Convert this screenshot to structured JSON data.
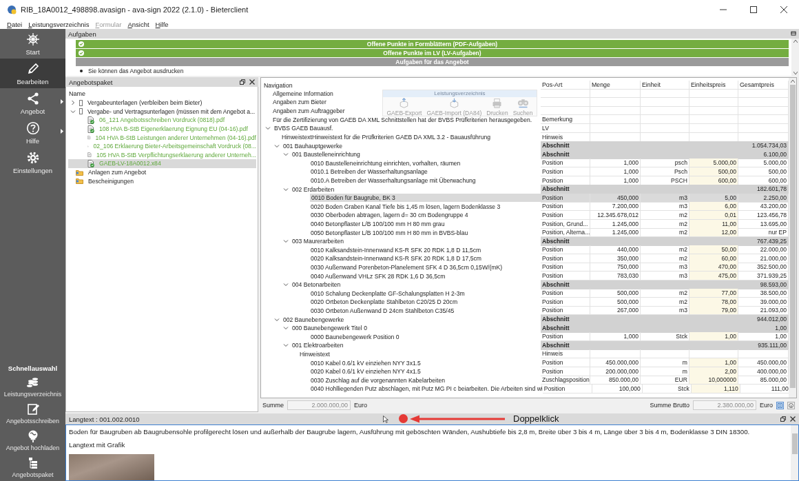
{
  "window": {
    "title": "RIB_18A0012_498898.avasign - ava-sign 2022 (2.1.0) - Bieterclient"
  },
  "menu": [
    {
      "label": "Datei",
      "disabled": false
    },
    {
      "label": "Leistungsverzeichnis",
      "disabled": false
    },
    {
      "label": "Formular",
      "disabled": true
    },
    {
      "label": "Ansicht",
      "disabled": false
    },
    {
      "label": "Hilfe",
      "disabled": false
    }
  ],
  "sidebar": {
    "items": [
      {
        "label": "Start",
        "kind": "start",
        "selected": false,
        "has_submenu": false
      },
      {
        "label": "Bearbeiten",
        "kind": "edit",
        "selected": true,
        "has_submenu": false
      },
      {
        "label": "Angebot",
        "kind": "share",
        "selected": false,
        "has_submenu": true
      },
      {
        "label": "Hilfe",
        "kind": "help",
        "selected": false,
        "has_submenu": true
      },
      {
        "label": "Einstellungen",
        "kind": "settings",
        "selected": false,
        "has_submenu": false
      }
    ],
    "quick_title": "Schnellauswahl",
    "quick_items": [
      {
        "label": "Leistungsverzeichnis",
        "kind": "coins"
      },
      {
        "label": "Angebotsschreiben",
        "kind": "letter"
      },
      {
        "label": "Angebot hochladen",
        "kind": "upload"
      },
      {
        "label": "Angebotspaket",
        "kind": "package"
      }
    ]
  },
  "tasks": {
    "title": "Aufgaben",
    "items": [
      {
        "kind": "done",
        "label": "Offene Punkte in Formblättern (PDF-Aufgaben)"
      },
      {
        "kind": "done",
        "label": "Offene Punkte im LV (LV-Aufgaben)"
      },
      {
        "kind": "heading",
        "label": "Aufgaben für das Angebot"
      },
      {
        "kind": "bullet",
        "label": "Sie können das Angebot ausdrucken"
      }
    ]
  },
  "package": {
    "title": "Angebotspaket",
    "column": "Name",
    "items": [
      {
        "label": "Vergabeunterlagen (verbleiben beim Bieter)",
        "kind": "group",
        "expanded": false,
        "selected": false
      },
      {
        "label": "Vergabe- und Vertragsunterlagen (müssen mit dem Angebot a...",
        "kind": "group",
        "expanded": true,
        "selected": false,
        "children": [
          {
            "label": "06_121 Angebotsschreiben Vordruck (0818).pdf",
            "kind": "file",
            "signed": true,
            "selected": false
          },
          {
            "label": "108 HVA B-StB Eigenerklaerung Eignung EU (04-16).pdf",
            "kind": "file",
            "signed": true,
            "selected": false
          },
          {
            "label": "104 HVA B-StB Leistungen anderer Unternehmen (04-16).pdf",
            "kind": "file",
            "signed": false,
            "selected": false
          },
          {
            "label": "02_106 Erklaerung Bieter-Arbeitsgemeinschaft Vordruck (08...",
            "kind": "file",
            "signed": false,
            "selected": false
          },
          {
            "label": "105 HVA B-StB Verpflichtungserklaerung anderer Unterneh...",
            "kind": "file",
            "signed": false,
            "selected": false
          },
          {
            "label": "GAEB-LV-18A0012.x84",
            "kind": "file",
            "signed": true,
            "selected": true
          }
        ]
      },
      {
        "label": "Anlagen zum Angebot",
        "kind": "folder",
        "selected": false
      },
      {
        "label": "Bescheinigungen",
        "kind": "folder",
        "selected": false
      }
    ]
  },
  "lv": {
    "columns": [
      "Navigation",
      "Pos-Art",
      "Menge",
      "Einheit",
      "Einheitspreis",
      "Gesamtpreis"
    ],
    "toolbar": {
      "title": "Leistungsverzeichnis",
      "buttons": [
        {
          "label": "GAEB-Export",
          "kind": "export"
        },
        {
          "label": "GAEB-Import (DA84)",
          "kind": "import"
        },
        {
          "label": "Drucken",
          "kind": "print"
        },
        {
          "label": "Suchen",
          "kind": "search"
        }
      ]
    },
    "rows": [
      {
        "label": "Allgemeine Information",
        "kind": "text",
        "selected": false
      },
      {
        "label": "Angaben zum Bieter",
        "kind": "text",
        "selected": false
      },
      {
        "label": "Angaben zum Auftraggeber",
        "kind": "text",
        "selected": false
      },
      {
        "label": "Für die Zertifizierung von GAEB DA XML Schnittstellen hat der BVBS Prüfkriterien herausgegeben.",
        "kind": "text",
        "selected": false,
        "pos_art": "Bemerkung"
      },
      {
        "label": "BVBS GAEB Bauausf.",
        "kind": "text",
        "selected": false,
        "pos_art": "LV",
        "expanded": true,
        "children": [
          {
            "label": "HinweistextHinweistext für die Prüfkriterien GAEB DA XML 3.2 - Bauausführung",
            "kind": "text",
            "selected": false,
            "pos_art": "Hinweis"
          },
          {
            "label": "001 Bauhauptgewerke",
            "kind": "section",
            "selected": false,
            "pos_art": "Abschnitt",
            "gp": "1.054.734,03",
            "expanded": true,
            "children": [
              {
                "label": "001 Baustelleneinrichtung",
                "kind": "section",
                "selected": false,
                "pos_art": "Abschnitt",
                "gp": "6.100,00",
                "expanded": true,
                "children": [
                  {
                    "label": "0010 Baustelleneinrichtung einrichten, vorhalten, räumen",
                    "kind": "position",
                    "selected": false,
                    "pos_art": "Position",
                    "menge": "1,000",
                    "einheit": "psch",
                    "ep": "5.000,00",
                    "gp": "5.000,00"
                  },
                  {
                    "label": "0010.1 Betreiben der Wasserhaltungsanlage",
                    "kind": "position",
                    "selected": false,
                    "pos_art": "Position",
                    "menge": "1,000",
                    "einheit": "Psch",
                    "ep": "500,00",
                    "gp": "500,00"
                  },
                  {
                    "label": "0010.A Betreiben der Wasserhaltungsanlage mit Überwachung",
                    "kind": "position",
                    "selected": false,
                    "pos_art": "Position",
                    "menge": "1,000",
                    "einheit": "PSCH",
                    "ep": "600,00",
                    "gp": "600,00"
                  }
                ]
              },
              {
                "label": "002 Erdarbeiten",
                "kind": "section",
                "selected": false,
                "pos_art": "Abschnitt",
                "gp": "182.601,78",
                "expanded": true,
                "children": [
                  {
                    "label": "0010 Boden für Baugrube, BK 3",
                    "kind": "position",
                    "selected": true,
                    "pos_art": "Position",
                    "menge": "450,000",
                    "einheit": "m3",
                    "ep": "5,00",
                    "gp": "2.250,00"
                  },
                  {
                    "label": "0020 Boden Graben Kanal Tiefe bis 1,45 m lösen, lagern Bodenklasse 3",
                    "kind": "position",
                    "selected": false,
                    "pos_art": "Position",
                    "menge": "7.200,000",
                    "einheit": "m3",
                    "ep": "6,00",
                    "gp": "43.200,00"
                  },
                  {
                    "label": "0030 Oberboden abtragen, lagern d= 30 cm Bodengruppe 4",
                    "kind": "position",
                    "selected": false,
                    "pos_art": "Position",
                    "menge": "12.345.678,012",
                    "einheit": "m2",
                    "ep": "0,01",
                    "gp": "123.456,78"
                  },
                  {
                    "label": "0040 Betonpflaster L/B 100/100 mm H 80 mm grau",
                    "kind": "position",
                    "selected": false,
                    "pos_art": "Position, Grund...",
                    "menge": "1.245,000",
                    "einheit": "m2",
                    "ep": "11,00",
                    "gp": "13.695,00"
                  },
                  {
                    "label": "0050 Betonpflaster L/B 100/100 mm H 80 mm in BVBS-blau",
                    "kind": "position",
                    "selected": false,
                    "pos_art": "Position, Alterna...",
                    "menge": "1.245,000",
                    "einheit": "m2",
                    "ep": "12,00",
                    "gp": "nur EP"
                  }
                ]
              },
              {
                "label": "003 Maurerarbeiten",
                "kind": "section",
                "selected": false,
                "pos_art": "Abschnitt",
                "gp": "767.439,25",
                "expanded": true,
                "children": [
                  {
                    "label": "0010 Kalksandstein-Innenwand KS-R SFK 20 RDK 1,8 D 11,5cm",
                    "kind": "position",
                    "selected": false,
                    "pos_art": "Position",
                    "menge": "440,000",
                    "einheit": "m2",
                    "ep": "50,00",
                    "gp": "22.000,00"
                  },
                  {
                    "label": "0020 Kalksandstein-Innenwand KS-R SFK 20 RDK 1,8 D 17,5cm",
                    "kind": "position",
                    "selected": false,
                    "pos_art": "Position",
                    "menge": "350,000",
                    "einheit": "m2",
                    "ep": "60,00",
                    "gp": "21.000,00"
                  },
                  {
                    "label": "0030 Außenwand Porenbeton-Planelement SFK 4 D 36,5cm 0,15W/(mK)",
                    "kind": "position",
                    "selected": false,
                    "pos_art": "Position",
                    "menge": "750,000",
                    "einheit": "m3",
                    "ep": "470,00",
                    "gp": "352.500,00"
                  },
                  {
                    "label": "0040 Außenwand VHLz SFK 28 RDK 1,6 D 36,5cm",
                    "kind": "position",
                    "selected": false,
                    "pos_art": "Position",
                    "menge": "783,030",
                    "einheit": "m3",
                    "ep": "475,00",
                    "gp": "371.939,25"
                  }
                ]
              },
              {
                "label": "004 Betonarbeiten",
                "kind": "section",
                "selected": false,
                "pos_art": "Abschnitt",
                "gp": "98.593,00",
                "expanded": true,
                "children": [
                  {
                    "label": "0010 Schalung Deckenplatte GF-Schalungsplatten H 2-3m",
                    "kind": "position",
                    "selected": false,
                    "pos_art": "Position",
                    "menge": "500,000",
                    "einheit": "m2",
                    "ep": "77,00",
                    "gp": "38.500,00"
                  },
                  {
                    "label": "0020 Ortbeton Deckenplatte Stahlbeton C20/25 D 20cm",
                    "kind": "position",
                    "selected": false,
                    "pos_art": "Position",
                    "menge": "500,000",
                    "einheit": "m2",
                    "ep": "78,00",
                    "gp": "39.000,00"
                  },
                  {
                    "label": "0030 Ortbeton Außenwand D 24cm Stahlbeton C35/45",
                    "kind": "position",
                    "selected": false,
                    "pos_art": "Position",
                    "menge": "267,000",
                    "einheit": "m3",
                    "ep": "79,00",
                    "gp": "21.093,00"
                  }
                ]
              }
            ]
          },
          {
            "label": "002 Baunebengewerke",
            "kind": "section",
            "selected": false,
            "pos_art": "Abschnitt",
            "gp": "944.012,00",
            "expanded": true,
            "children": [
              {
                "label": "000 Baunebengewerk Titel 0",
                "kind": "section",
                "selected": false,
                "pos_art": "Abschnitt",
                "gp": "1,00",
                "expanded": true,
                "children": [
                  {
                    "label": "0000 Baunebengewerk Position 0",
                    "kind": "position",
                    "selected": false,
                    "pos_art": "Position",
                    "menge": "1,000",
                    "einheit": "Stck",
                    "ep": "1,00",
                    "gp": "1,00"
                  }
                ]
              },
              {
                "label": "001 Elektroarbeiten",
                "kind": "section",
                "selected": false,
                "pos_art": "Abschnitt",
                "gp": "935.111,00",
                "expanded": true,
                "children": [
                  {
                    "label": "Hinweistext",
                    "kind": "text",
                    "selected": false,
                    "pos_art": "Hinweis"
                  },
                  {
                    "label": "0010 Kabel 0.6/1 kV einziehen NYY 3x1.5",
                    "kind": "position",
                    "selected": false,
                    "pos_art": "Position",
                    "menge": "450.000,000",
                    "einheit": "m",
                    "ep": "1,00",
                    "gp": "450.000,00"
                  },
                  {
                    "label": "0020 Kabel 0.6/1 kV einziehen NYY 4x1.5",
                    "kind": "position",
                    "selected": false,
                    "pos_art": "Position",
                    "menge": "200.000,000",
                    "einheit": "m",
                    "ep": "2,00",
                    "gp": "400.000,00"
                  },
                  {
                    "label": "0030 Zuschlag auf die vorgenannten Kabelarbeiten",
                    "kind": "position",
                    "selected": false,
                    "pos_art": "Zuschlagsposition",
                    "menge": "850.000,00",
                    "einheit": "EUR",
                    "ep": "10,000000",
                    "gp": "85.000,00"
                  },
                  {
                    "label": "0040 Hohlliegenden Putz abschlagen, mit Putz MG PI c beiarbeiten. Die Arbeiten sind wi",
                    "kind": "position",
                    "selected": false,
                    "pos_art": "Position",
                    "menge": "100,000",
                    "einheit": "Stck",
                    "ep": "1,110",
                    "gp": "111,00"
                  }
                ]
              }
            ]
          }
        ]
      }
    ],
    "sum": {
      "label": "Summe",
      "value": "2.000.000,00",
      "unit": "Euro"
    },
    "gross": {
      "label": "Summe Brutto",
      "value": "2.380.000,00",
      "unit": "Euro"
    },
    "view_buttons": [
      {
        "kind": "list",
        "selected": true
      },
      {
        "kind": "info",
        "selected": false
      }
    ]
  },
  "langtext": {
    "title": "Langtext : 001.002.0010",
    "text": "Boden für Baugruben ab Baugrubensohle profilgerecht lösen und außerhalb der Baugrube lagern, Ausführung mit geböschten Wänden, Aushubtiefe bis 2,8 m, Breite über 3 bis 4 m, Länge über 3 bis 4 m, Bodenklasse 3 DIN 18300.",
    "subtitle": "Langtext mit Grafik",
    "annotation": "Doppelklick"
  }
}
